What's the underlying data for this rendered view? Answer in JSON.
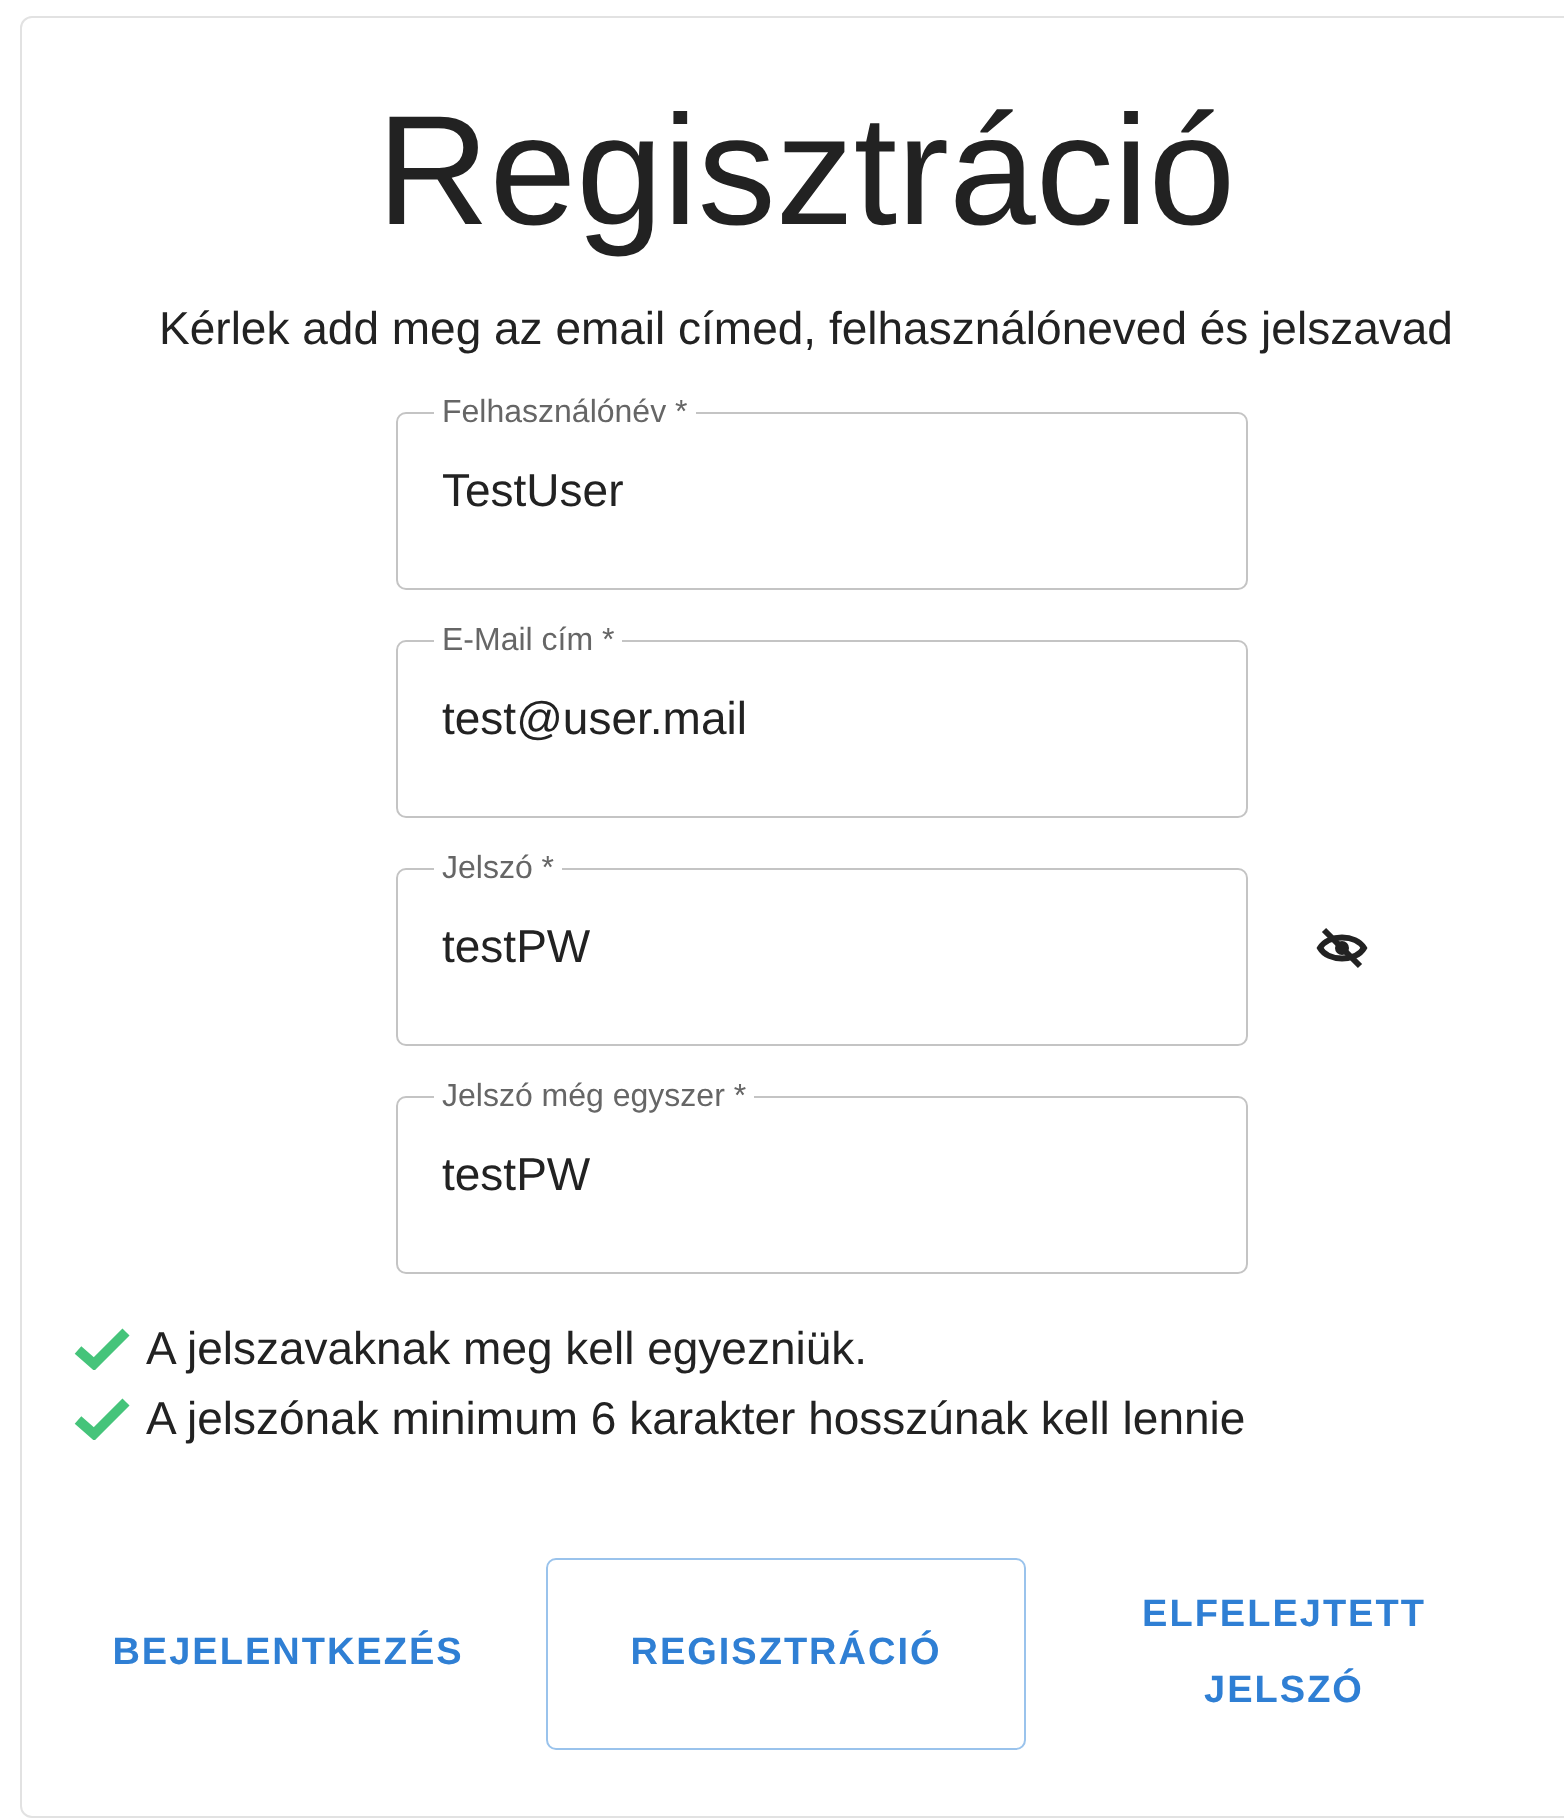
{
  "title": "Regisztráció",
  "subtitle": "Kérlek add meg az email címed, felhasználóneved és jelszavad",
  "fields": [
    {
      "label": "Felhasználónév *",
      "value": "TestUser",
      "visibility_toggle": false
    },
    {
      "label": "E-Mail cím *",
      "value": "test@user.mail",
      "visibility_toggle": false
    },
    {
      "label": "Jelszó *",
      "value": "testPW",
      "visibility_toggle": true
    },
    {
      "label": "Jelszó még egyszer *",
      "value": "testPW",
      "visibility_toggle": false
    }
  ],
  "rules": [
    {
      "text": "A jelszavaknak meg kell egyezniük.",
      "met": true
    },
    {
      "text": "A jelszónak minimum 6 karakter hosszúnak kell lennie",
      "met": true
    }
  ],
  "buttons": [
    {
      "label": "BEJELENTKEZÉS",
      "kind": "text"
    },
    {
      "label": "REGISZTRÁCIÓ",
      "kind": "outlined"
    },
    {
      "label": "ELFELEJTETT JELSZÓ",
      "kind": "text"
    }
  ]
}
